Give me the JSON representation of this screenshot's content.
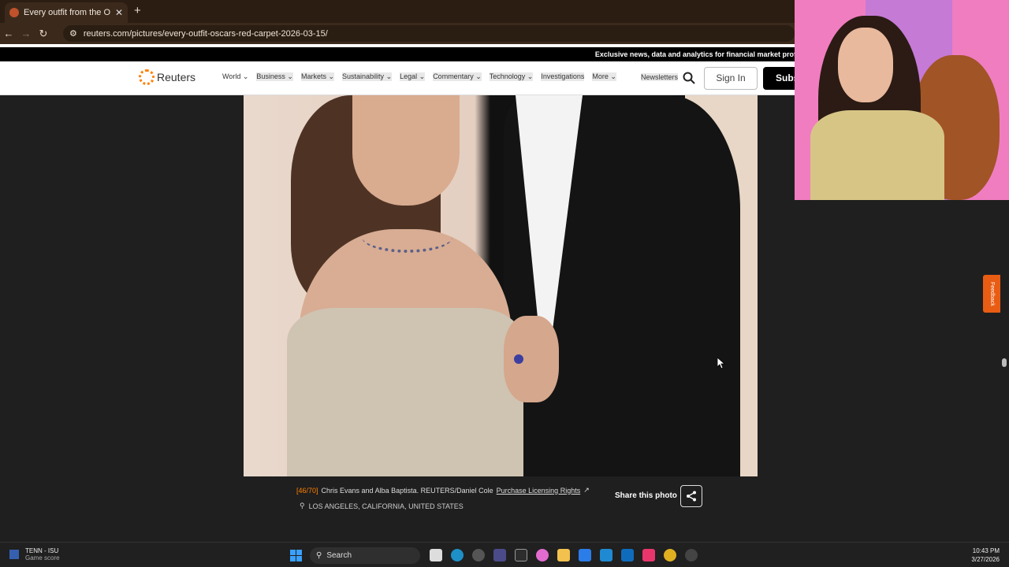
{
  "browser": {
    "tab_title": "Every outfit from the Oscars re",
    "tab_close": "✕",
    "new_tab": "+",
    "url": "reuters.com/pictures/every-outfit-oscars-red-carpet-2026-03-15/"
  },
  "reuters": {
    "banner": "Exclusive news, data and analytics for financial market prof",
    "logo": "Reuters",
    "nav_items": [
      "World",
      "Business",
      "Markets",
      "Sustainability",
      "Legal",
      "Commentary",
      "Technology",
      "Investigations",
      "More"
    ],
    "newsletters": "Newsletters",
    "sign_in": "Sign In",
    "subscribe": "Subs"
  },
  "photo": {
    "counter": "[46/70]",
    "caption": "Chris Evans and Alba Baptista. REUTERS/Daniel Cole",
    "licensing": "Purchase Licensing Rights",
    "location": "LOS ANGELES, CALIFORNIA, UNITED STATES",
    "share_label": "Share this photo"
  },
  "feedback": "Feedback",
  "taskbar": {
    "score_title": "TENN - ISU",
    "score_sub": "Game score",
    "search_placeholder": "Search",
    "time": "10:43 PM",
    "date": "3/27/2026"
  },
  "colors": {
    "accent": "#ff8000",
    "banner_bg": "#000000",
    "page_bg": "#1f1f1f"
  }
}
